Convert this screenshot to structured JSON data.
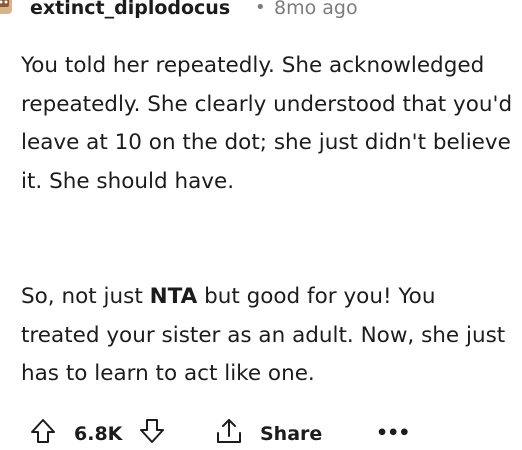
{
  "comment": {
    "author": "extinct_diplodocus",
    "separator": "•",
    "age": "8mo ago",
    "paragraph1": "You told her repeatedly. She acknowledged repeatedly. She clearly understood that you'd leave at 10 on the dot; she just didn't believe it. She should have.",
    "paragraph2_before": "So, not just ",
    "paragraph2_bold": "NTA",
    "paragraph2_after": " but good for you! You treated your sister as an adult. Now, she just has to learn to act like one."
  },
  "actions": {
    "score": "6.8K",
    "share_label": "Share",
    "more_label": "•••"
  },
  "icons": {
    "avatar": "avatar-icon",
    "upvote": "upvote-arrow-icon",
    "downvote": "downvote-arrow-icon",
    "share": "share-icon",
    "more": "more-options-icon"
  }
}
